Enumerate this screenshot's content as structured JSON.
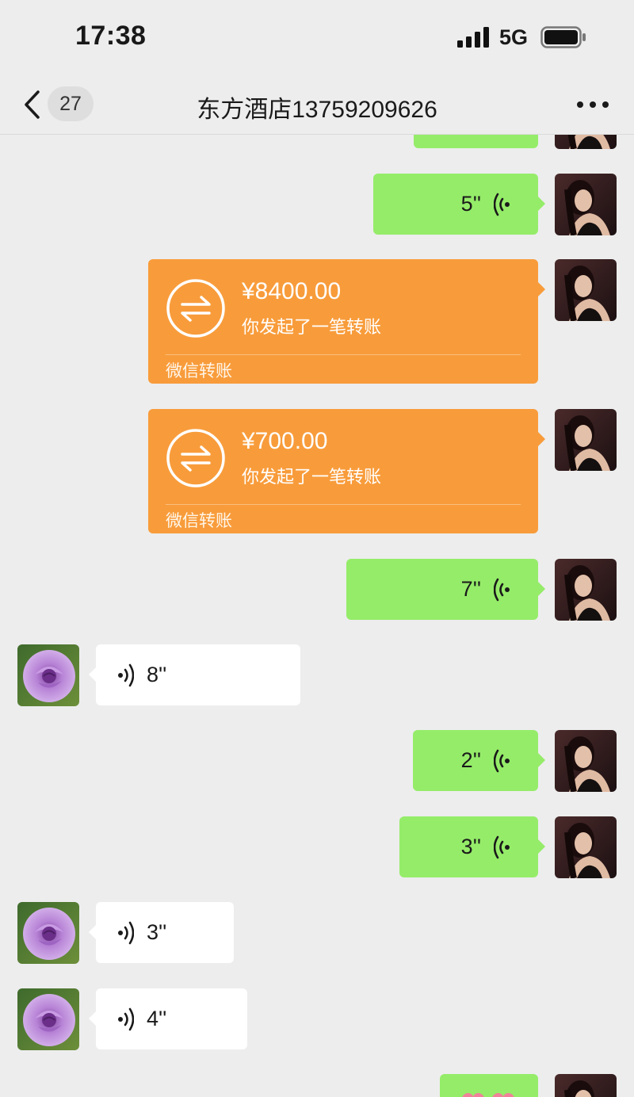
{
  "status_bar": {
    "time": "17:38",
    "network": "5G"
  },
  "nav": {
    "unread_count": "27",
    "title": "东方酒店13759209626"
  },
  "messages": {
    "voice_out_1": "5''",
    "transfer_1": {
      "amount": "¥8400.00",
      "description": "你发起了一笔转账",
      "source": "微信转账"
    },
    "transfer_2": {
      "amount": "¥700.00",
      "description": "你发起了一笔转账",
      "source": "微信转账"
    },
    "voice_out_2": "7''",
    "voice_in_1": "8''",
    "voice_out_3": "2''",
    "voice_out_4": "3''",
    "voice_in_2": "3''",
    "voice_in_3": "4''"
  },
  "colors": {
    "background": "#ededed",
    "sent_bubble": "#95ec69",
    "received_bubble": "#ffffff",
    "transfer_card": "#f89c3b"
  },
  "icons": {
    "back": "chevron-left-icon",
    "more": "more-dots-icon",
    "voice": "voice-wave-icon",
    "transfer": "transfer-arrows-icon",
    "contact_avatar": "purple-rose-avatar",
    "self_avatar": "woman-portrait-avatar"
  }
}
